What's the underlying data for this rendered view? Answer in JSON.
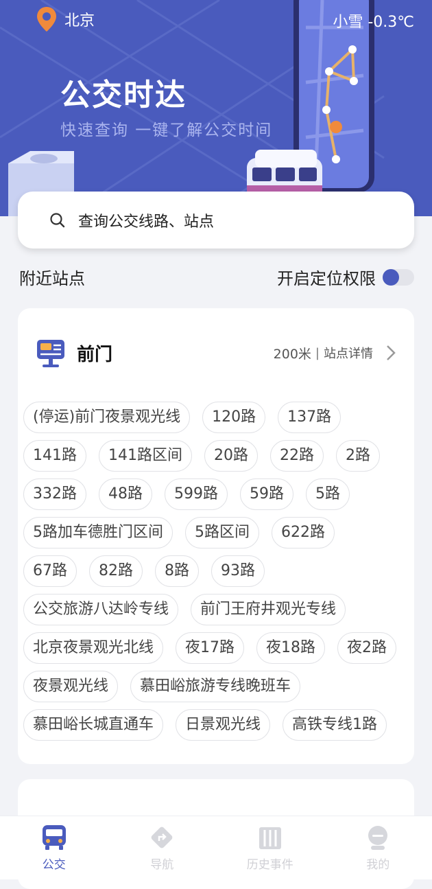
{
  "header": {
    "city": "北京",
    "weather": "小雪 -0.3℃",
    "title": "公交时达",
    "subtitle": "快速查询 一键了解公交时间"
  },
  "search": {
    "placeholder": "查询公交线路、站点"
  },
  "nearby": {
    "title": "附近站点",
    "location_permission_label": "开启定位权限"
  },
  "stop": {
    "name": "前门",
    "distance": "200米",
    "detail_label": "站点详情",
    "routes": [
      "(停运)前门夜景观光线",
      "120路",
      "137路",
      "141路",
      "141路区间",
      "20路",
      "22路",
      "2路",
      "332路",
      "48路",
      "599路",
      "59路",
      "5路",
      "5路加车德胜门区间",
      "5路区间",
      "622路",
      "67路",
      "82路",
      "8路",
      "93路",
      "公交旅游八达岭专线",
      "前门王府井观光专线",
      "北京夜景观光北线",
      "夜17路",
      "夜18路",
      "夜2路",
      "夜景观光线",
      "慕田峪旅游专线晚班车",
      "慕田峪长城直通车",
      "日景观光线",
      "高铁专线1路"
    ]
  },
  "tabs": [
    {
      "label": "公交",
      "icon": "bus-icon",
      "active": true
    },
    {
      "label": "导航",
      "icon": "navigation-icon",
      "active": false
    },
    {
      "label": "历史事件",
      "icon": "history-icon",
      "active": false
    },
    {
      "label": "我的",
      "icon": "profile-icon",
      "active": false
    }
  ],
  "colors": {
    "brand": "#4a5bbd",
    "pin": "#f08a3c"
  }
}
